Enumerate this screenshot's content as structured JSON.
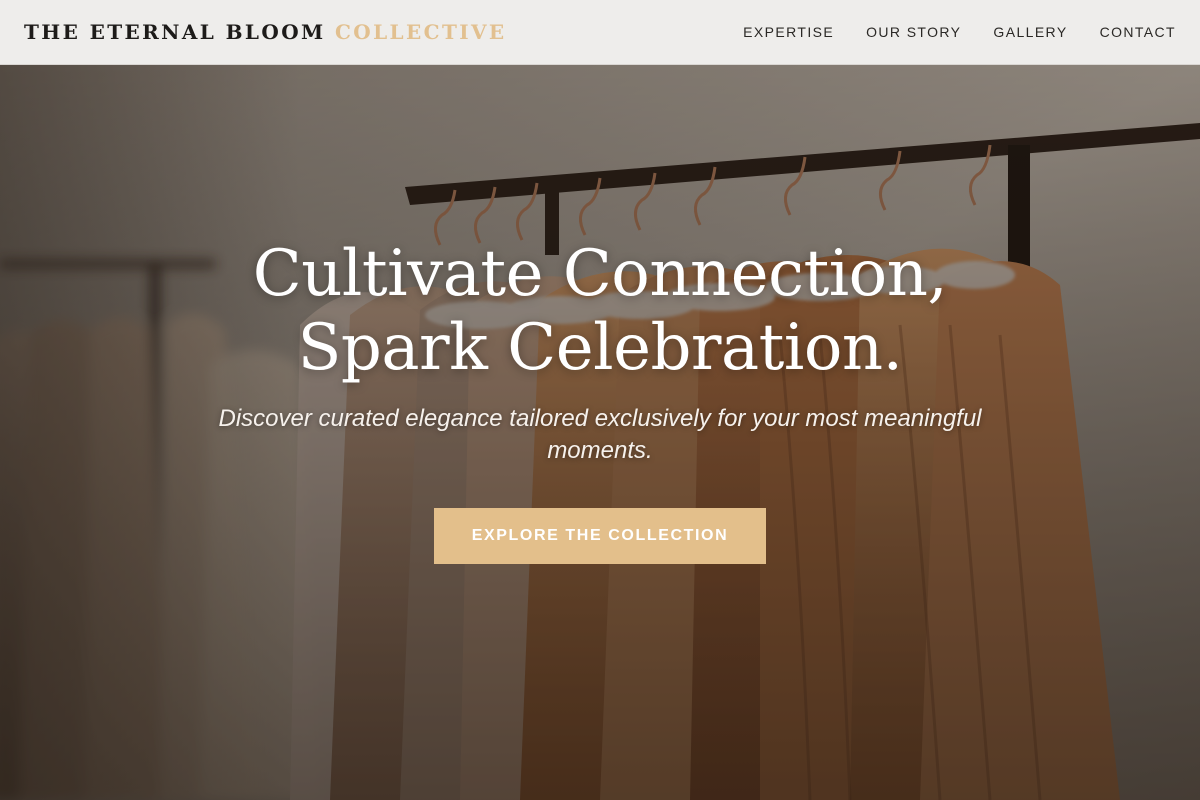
{
  "brand": {
    "name_main": "THE ETERNAL BLOOM",
    "name_accent": "COLLECTIVE"
  },
  "nav": {
    "items": [
      {
        "label": "EXPERTISE"
      },
      {
        "label": "OUR STORY"
      },
      {
        "label": "GALLERY"
      },
      {
        "label": "CONTACT"
      }
    ]
  },
  "hero": {
    "title_line1": "Cultivate Connection,",
    "title_line2": "Spark Celebration.",
    "subtitle": "Discover curated elegance tailored exclusively for your most meaningful moments.",
    "cta_label": "EXPLORE THE COLLECTION",
    "background_image": "photo of dresses on a clothing rack"
  },
  "colors": {
    "accent": "#e2c08f",
    "button": "#e3bf8b",
    "header_bg": "#eeedeb",
    "text_dark": "#1d1b19"
  }
}
